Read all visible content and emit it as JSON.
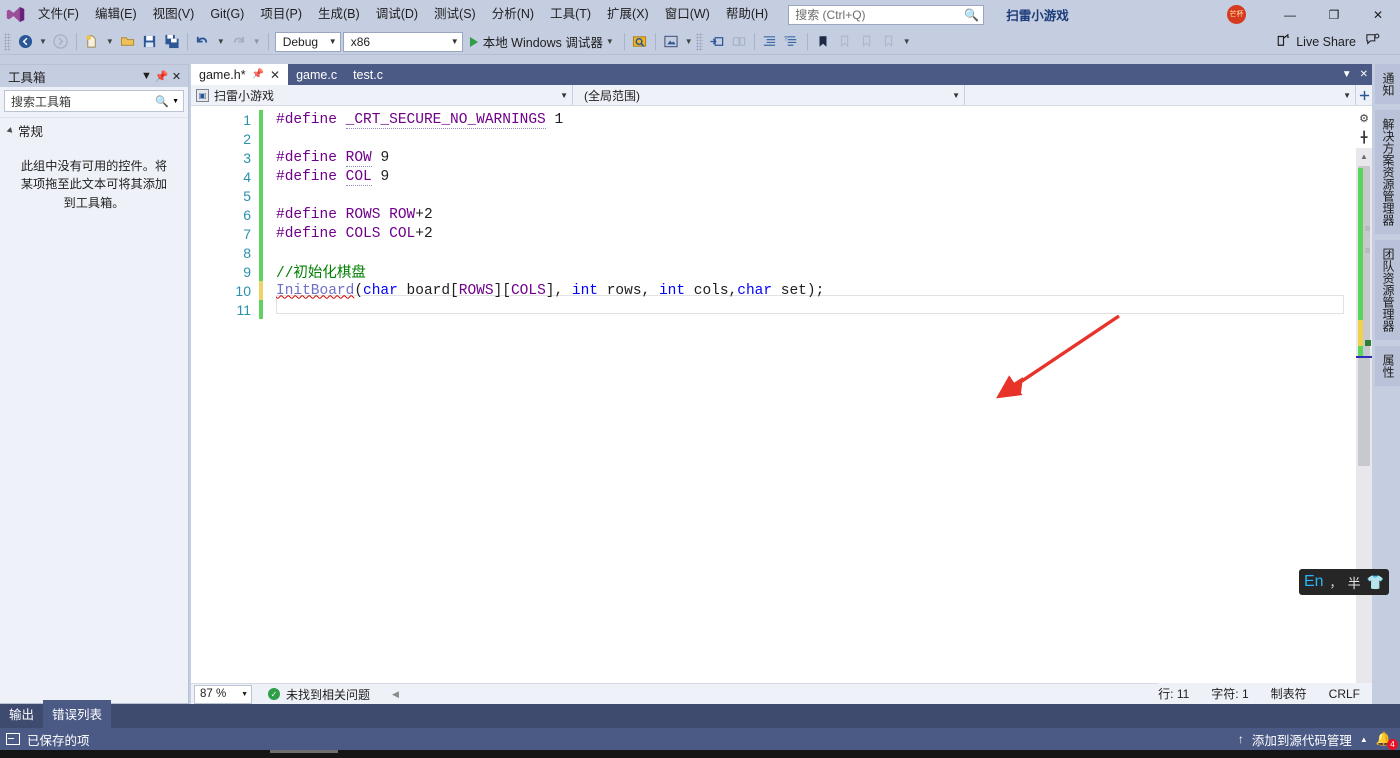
{
  "app": {
    "logo_icon": "visual-studio-logo",
    "solution_name": "扫雷小游戏"
  },
  "menubar": {
    "items": [
      {
        "label": "文件(F)"
      },
      {
        "label": "编辑(E)"
      },
      {
        "label": "视图(V)"
      },
      {
        "label": "Git(G)"
      },
      {
        "label": "项目(P)"
      },
      {
        "label": "生成(B)"
      },
      {
        "label": "调试(D)"
      },
      {
        "label": "测试(S)"
      },
      {
        "label": "分析(N)"
      },
      {
        "label": "工具(T)"
      },
      {
        "label": "扩展(X)"
      },
      {
        "label": "窗口(W)"
      },
      {
        "label": "帮助(H)"
      }
    ],
    "search": {
      "placeholder": "搜索 (Ctrl+Q)",
      "icon": "search-icon"
    },
    "window_controls": {
      "minimize": "—",
      "maximize": "❐",
      "close": "✕"
    },
    "avatar_label": "芒杯"
  },
  "toolbar": {
    "back_icon": "navigate-back-icon",
    "forward_icon": "navigate-forward-icon",
    "new_item_icon": "new-file-icon",
    "open_icon": "open-file-icon",
    "save_icon": "save-icon",
    "save_all_icon": "save-all-icon",
    "undo_icon": "undo-icon",
    "redo_icon": "redo-icon",
    "config_value": "Debug",
    "platform_value": "x86",
    "run_label": "本地 Windows 调试器",
    "run_icon": "play-icon",
    "icons_right": [
      "hot-reload-icon",
      "screenshot-icon",
      "step-into-icon",
      "step-over-icon",
      "indent-icon",
      "comment-icon",
      "bookmark-icon",
      "next-bookmark-icon",
      "prev-bookmark-icon",
      "clear-bookmarks-icon"
    ],
    "live_share_label": "Live Share",
    "live_share_icon": "live-share-icon",
    "feedback_icon": "feedback-icon"
  },
  "toolbox": {
    "title": "工具箱",
    "dropdown_icon": "chevron-down-icon",
    "pin_icon": "pin-icon",
    "close_icon": "close-icon",
    "search_placeholder": "搜索工具箱",
    "search_icon": "search-icon",
    "group_label": "常规",
    "empty_message": "此组中没有可用的控件。将某项拖至此文本可将其添加到工具箱。"
  },
  "editor": {
    "tabs": [
      {
        "label": "game.h*",
        "active": true,
        "pin_icon": "pin-icon",
        "close_icon": "close-icon"
      },
      {
        "label": "game.c",
        "active": false
      },
      {
        "label": "test.c",
        "active": false
      }
    ],
    "navbar": {
      "project": "扫雷小游戏",
      "project_icon": "project-icon",
      "scope": "(全局范围)",
      "member": "",
      "dropdown_icon": "chevron-down-icon"
    },
    "lines": [
      {
        "num": "1",
        "marker": "saved",
        "html": "<span class='k-pre'>#define</span> <span class='k-macro dots'>_CRT_SECURE_NO_WARNINGS</span> <span class='k-num'>1</span>"
      },
      {
        "num": "2",
        "marker": "saved",
        "html": ""
      },
      {
        "num": "3",
        "marker": "saved",
        "html": "<span class='k-pre'>#define</span> <span class='k-macro dots'>ROW</span> <span class='k-num'>9</span>"
      },
      {
        "num": "4",
        "marker": "saved",
        "html": "<span class='k-pre'>#define</span> <span class='k-macro dots'>COL</span> <span class='k-num'>9</span>"
      },
      {
        "num": "5",
        "marker": "saved",
        "html": ""
      },
      {
        "num": "6",
        "marker": "saved",
        "html": "<span class='k-pre'>#define</span> <span class='k-macro'>ROWS</span> <span class='k-macro'>ROW</span><span class='k-plain'>+2</span>"
      },
      {
        "num": "7",
        "marker": "saved",
        "html": "<span class='k-pre'>#define</span> <span class='k-macro'>COLS</span> <span class='k-macro'>COL</span><span class='k-plain'>+2</span>"
      },
      {
        "num": "8",
        "marker": "saved",
        "html": ""
      },
      {
        "num": "9",
        "marker": "saved",
        "html": "<span class='k-cmt'>//初始化棋盘</span>"
      },
      {
        "num": "10",
        "marker": "edited",
        "html": "<span class='k-fn squig-red'>InitBoard</span><span class='k-plain'>(</span><span class='k-kw'>char</span><span class='k-plain'> board[</span><span class='k-macro'>ROWS</span><span class='k-plain'>][</span><span class='k-macro'>COLS</span><span class='k-plain'>], </span><span class='k-kw'>int</span><span class='k-plain'> rows, </span><span class='k-kw'>int</span><span class='k-plain'> cols,</span><span class='k-kw'>char</span><span class='k-plain'> set);</span>"
      },
      {
        "num": "11",
        "marker": "saved",
        "html": ""
      }
    ],
    "plain_lines": [
      "#define _CRT_SECURE_NO_WARNINGS 1",
      "",
      "#define ROW 9",
      "#define COL 9",
      "",
      "#define ROWS ROW+2",
      "#define COLS COL+2",
      "",
      "//初始化棋盘",
      "InitBoard(char board[ROWS][COLS], int rows, int cols,char set);",
      ""
    ],
    "annotation": {
      "type": "red-arrow",
      "color": "#e8332a",
      "points_to": "line-10-close-paren"
    },
    "status": {
      "zoom": "87 %",
      "zoom_dropdown_icon": "chevron-down-icon",
      "issues": "未找到相关问题",
      "issues_icon": "check-circle-icon",
      "prev_icon": "prev-issue-icon",
      "next_icon": "next-issue-icon"
    }
  },
  "right_tabs": [
    {
      "label": "通知"
    },
    {
      "label": "解决方案资源管理器"
    },
    {
      "label": "团队资源管理器"
    },
    {
      "label": "属性"
    }
  ],
  "right_icons": {
    "settings_icon": "gear-icon",
    "split_icon": "split-view-icon"
  },
  "statusbar": {
    "line_label": "行: 11",
    "col_label": "字符: 1",
    "tabs_label": "制表符",
    "eol_label": "CRLF"
  },
  "bottom": {
    "tabs": [
      {
        "label": "输出",
        "active": false
      },
      {
        "label": "错误列表",
        "active": true
      }
    ],
    "saved_label": "已保存的项",
    "saved_icon": "saved-item-icon",
    "source_control_label": "添加到源代码管理",
    "source_control_icon": "upload-icon",
    "source_control_caret": "chevron-up-icon",
    "bell_icon": "notification-bell-icon",
    "bell_count": "4"
  },
  "ime": {
    "mode": "En",
    "punct": "，",
    "width": "半",
    "skin_icon": "shirt-icon"
  },
  "colors": {
    "chrome": "#c5cde0",
    "tab_strip": "#4b5a85",
    "accent_blue": "#2b5797",
    "keyword": "#0000ff",
    "macro": "#6f008a",
    "comment": "#008000",
    "function": "#6f6fc8",
    "linenum": "#2b91af",
    "saved_marker": "#62d162",
    "edited_marker": "#f0d26a",
    "annotation_red": "#e8332a"
  }
}
